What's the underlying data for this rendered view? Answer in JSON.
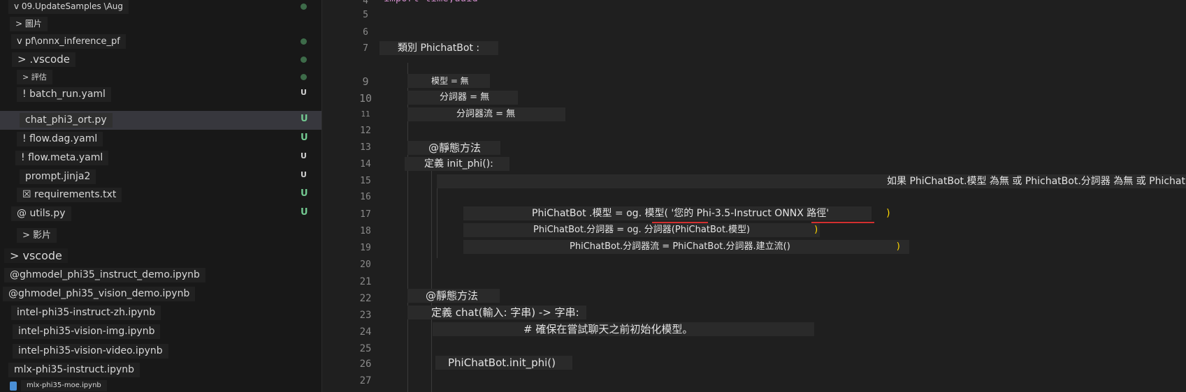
{
  "explorer": {
    "items": [
      {
        "label": "v 09.UpdateSamples \\Aug",
        "status": "dot"
      },
      {
        "label": "> 圖片",
        "status": ""
      },
      {
        "label": "v pf\\onnx_inference_pf",
        "status": "dot"
      },
      {
        "label": "> .vscode",
        "status": "dot"
      },
      {
        "label": "> 評估",
        "status": "dot"
      },
      {
        "label": "! batch_run.yaml",
        "status": "U"
      },
      {
        "label": "chat_phi3_ort.py",
        "status": "U"
      },
      {
        "label": "! flow.dag.yaml",
        "status": "U"
      },
      {
        "label": "! flow.meta.yaml",
        "status": "U"
      },
      {
        "label": "prompt.jinja2",
        "status": "U"
      },
      {
        "label": "☒ requirements.txt",
        "status": "U"
      },
      {
        "label": "@ utils.py",
        "status": "U"
      },
      {
        "label": "> 影片",
        "status": ""
      },
      {
        "label": "> vscode",
        "status": ""
      },
      {
        "label": "@ghmodel_phi35_instruct_demo.ipynb",
        "status": ""
      },
      {
        "label": "@ghmodel_phi35_vision_demo.ipynb",
        "status": ""
      },
      {
        "label": "intel-phi35-instruct-zh.ipynb",
        "status": ""
      },
      {
        "label": "intel-phi35-vision-img.ipynb",
        "status": ""
      },
      {
        "label": "intel-phi35-vision-video.ipynb",
        "status": ""
      },
      {
        "label": "mlx-phi35-instruct.ipynb",
        "status": ""
      },
      {
        "label": "mlx-phi35-moe.ipynb",
        "status": ""
      }
    ]
  },
  "editor": {
    "line_numbers": [
      "4",
      "5",
      "6",
      "7",
      "9",
      "10",
      "11",
      "12",
      "13",
      "14",
      "15",
      "16",
      "17",
      "18",
      "19",
      "20",
      "21",
      "22",
      "23",
      "24",
      "25",
      "26",
      "27"
    ],
    "top_partial": "import time,uuid",
    "lines": {
      "l7": "類別 PhichatBot :",
      "l9": "模型 = 無",
      "l10": "分詞器 = 無",
      "l11": "分詞器流 = 無",
      "l13": "@靜態方法",
      "l14": "定義 init_phi():",
      "l15": "如果 PhiChatBot.模型 為無 或 PhichatBot.分詞器 為無 或 PhichatBot.分詞器流 為無:",
      "l17": "PhiChatBot .模型 = og. 模型( '您的 Phi-3.5-Instruct ONNX 路徑'",
      "l17_paren": ")",
      "l18": "PhiChatBot.分詞器 = og. 分詞器(PhiChatBot.模型)",
      "l18_paren": ")",
      "l19": "PhiChatBot.分詞器流 = PhiChatBot.分詞器.建立流()",
      "l19_paren": ")",
      "l22": "@靜態方法",
      "l23": "定義 chat(輸入: 字串) -> 字串:",
      "l24": "# 確保在嘗試聊天之前初始化模型。",
      "l26": "PhiChatBot.init_phi()"
    }
  }
}
